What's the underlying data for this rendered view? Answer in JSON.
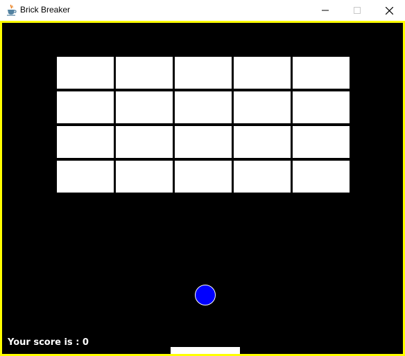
{
  "window": {
    "title": "Brick Breaker",
    "app_icon": "java-cup-icon",
    "controls": {
      "minimize_icon": "minimize-icon",
      "maximize_icon": "maximize-icon",
      "close_icon": "close-icon"
    }
  },
  "game": {
    "border_color": "#ffff00",
    "background_color": "#000000",
    "brick_color": "#ffffff",
    "ball_color": "#0000ff",
    "paddle_color": "#ffffff",
    "brick_grid": {
      "rows": 4,
      "columns": 5
    },
    "score_text": "Your score is : 0"
  }
}
